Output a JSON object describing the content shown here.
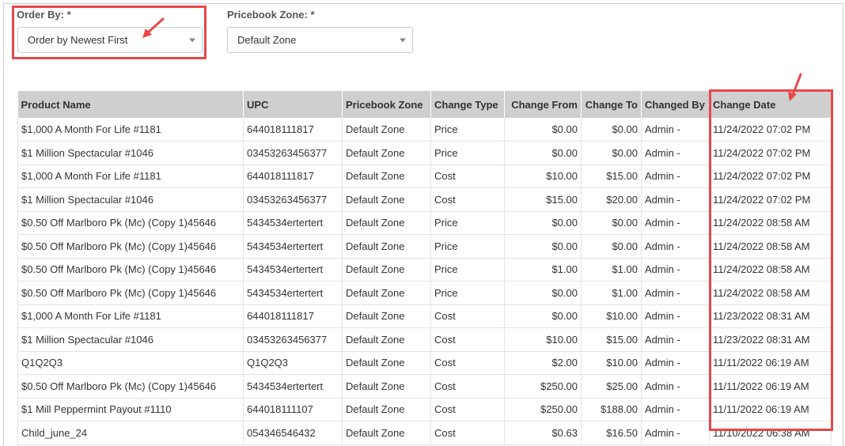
{
  "filters": {
    "order_by": {
      "label": "Order By: *",
      "value": "Order by Newest First"
    },
    "pricebook_zone": {
      "label": "Pricebook Zone: *",
      "value": "Default Zone"
    }
  },
  "table": {
    "headers": [
      "Product Name",
      "UPC",
      "Pricebook Zone",
      "Change Type",
      "Change From",
      "Change To",
      "Changed By",
      "Change Date"
    ],
    "rows": [
      [
        "$1,000 A Month For Life #1181",
        "644018111817",
        "Default Zone",
        "Price",
        "$0.00",
        "$0.00",
        "Admin -",
        "11/24/2022 07:02 PM"
      ],
      [
        "$1 Million Spectacular #1046",
        "03453263456377",
        "Default Zone",
        "Price",
        "$0.00",
        "$0.00",
        "Admin -",
        "11/24/2022 07:02 PM"
      ],
      [
        "$1,000 A Month For Life #1181",
        "644018111817",
        "Default Zone",
        "Cost",
        "$10.00",
        "$15.00",
        "Admin -",
        "11/24/2022 07:02 PM"
      ],
      [
        "$1 Million Spectacular #1046",
        "03453263456377",
        "Default Zone",
        "Cost",
        "$15.00",
        "$20.00",
        "Admin -",
        "11/24/2022 07:02 PM"
      ],
      [
        "$0.50 Off Marlboro Pk (Mc) (Copy 1)45646",
        "5434534ertertert",
        "Default Zone",
        "Price",
        "$0.00",
        "$0.00",
        "Admin -",
        "11/24/2022 08:58 AM"
      ],
      [
        "$0.50 Off Marlboro Pk (Mc) (Copy 1)45646",
        "5434534ertertert",
        "Default Zone",
        "Price",
        "$0.00",
        "$0.00",
        "Admin -",
        "11/24/2022 08:58 AM"
      ],
      [
        "$0.50 Off Marlboro Pk (Mc) (Copy 1)45646",
        "5434534ertertert",
        "Default Zone",
        "Price",
        "$1.00",
        "$1.00",
        "Admin -",
        "11/24/2022 08:58 AM"
      ],
      [
        "$0.50 Off Marlboro Pk (Mc) (Copy 1)45646",
        "5434534ertertert",
        "Default Zone",
        "Price",
        "$0.00",
        "$1.00",
        "Admin -",
        "11/24/2022 08:58 AM"
      ],
      [
        "$1,000 A Month For Life #1181",
        "644018111817",
        "Default Zone",
        "Cost",
        "$0.00",
        "$10.00",
        "Admin -",
        "11/23/2022 08:31 AM"
      ],
      [
        "$1 Million Spectacular #1046",
        "03453263456377",
        "Default Zone",
        "Cost",
        "$10.00",
        "$15.00",
        "Admin -",
        "11/23/2022 08:31 AM"
      ],
      [
        "Q1Q2Q3",
        "Q1Q2Q3",
        "Default Zone",
        "Cost",
        "$2.00",
        "$10.00",
        "Admin -",
        "11/11/2022 06:19 AM"
      ],
      [
        "$0.50 Off Marlboro Pk (Mc) (Copy 1)45646",
        "5434534ertertert",
        "Default Zone",
        "Cost",
        "$250.00",
        "$25.00",
        "Admin -",
        "11/11/2022 06:19 AM"
      ],
      [
        "$1 Mill Peppermint Payout #1110",
        "644018111107",
        "Default Zone",
        "Cost",
        "$250.00",
        "$188.00",
        "Admin -",
        "11/11/2022 06:19 AM"
      ],
      [
        "Child_june_24",
        "054346546432",
        "Default Zone",
        "Cost",
        "$0.63",
        "$16.50",
        "Admin -",
        "11/10/2022 06:38 AM"
      ]
    ]
  },
  "colors": {
    "highlight": "#e8474a",
    "header_bg": "#cfcfcf"
  }
}
